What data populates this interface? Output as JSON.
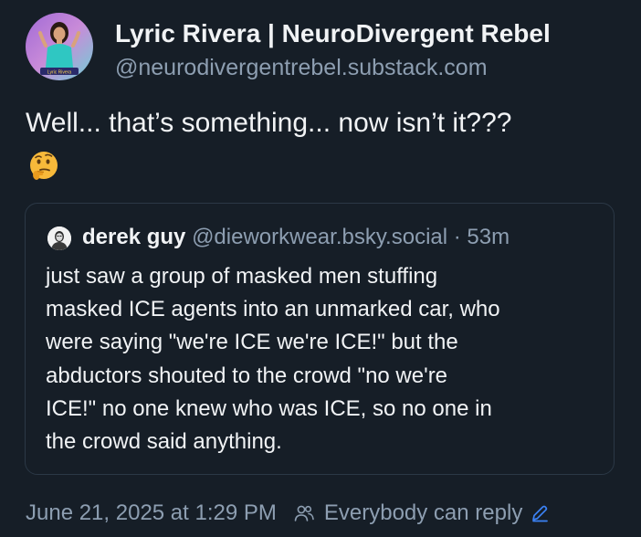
{
  "author": {
    "display_name": "Lyric Rivera | NeuroDivergent Rebel",
    "handle": "@neurodivergentrebel.substack.com",
    "avatar_caption": "Lyric Rivera"
  },
  "post": {
    "text": "Well... that’s something... now isn’t it???",
    "emoji": "thinking-face-emoji"
  },
  "quote": {
    "author_name": "derek guy",
    "author_handle": "@dieworkwear.bsky.social",
    "separator": " · ",
    "time": "53m",
    "lines": [
      "just saw a group of masked men stuffing",
      "masked ICE agents into an unmarked car, who",
      "were saying \"we're ICE we're ICE!\" but the",
      "abductors shouted to the crowd \"no we're",
      "ICE!\" no one knew who was ICE, so no one in",
      "the crowd said anything."
    ]
  },
  "footer": {
    "timestamp": "June 21, 2025 at 1:29 PM",
    "reply_setting": "Everybody can reply",
    "icons": [
      "people-icon",
      "pencil-icon"
    ]
  },
  "colors": {
    "background": "#161e27",
    "text_primary": "#f1f3f5",
    "text_secondary": "#8d9eb1",
    "border": "#2b3846",
    "accent": "#3b82f6"
  }
}
